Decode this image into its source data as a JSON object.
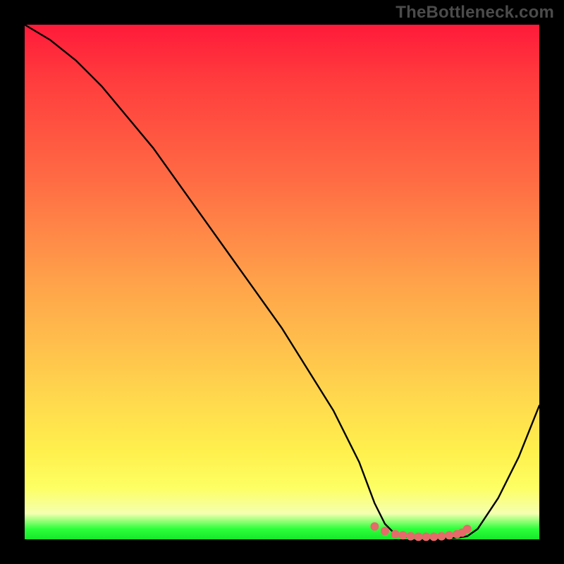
{
  "watermark": "TheBottleneck.com",
  "chart_data": {
    "type": "line",
    "title": "",
    "xlabel": "",
    "ylabel": "",
    "xlim": [
      0,
      100
    ],
    "ylim": [
      0,
      100
    ],
    "series": [
      {
        "name": "curve",
        "x": [
          0,
          5,
          10,
          15,
          20,
          25,
          30,
          35,
          40,
          45,
          50,
          55,
          60,
          65,
          68,
          70,
          72,
          74,
          76,
          78,
          80,
          82,
          84,
          86,
          88,
          92,
          96,
          100
        ],
        "y": [
          100,
          97,
          93,
          88,
          82,
          76,
          69,
          62,
          55,
          48,
          41,
          33,
          25,
          15,
          7,
          3,
          1,
          0.5,
          0.3,
          0.2,
          0.2,
          0.2,
          0.3,
          0.6,
          2,
          8,
          16,
          26
        ]
      }
    ],
    "markers": {
      "name": "bottom-dots",
      "x": [
        68,
        70,
        72,
        73.5,
        75,
        76.5,
        78,
        79.5,
        81,
        82.5,
        84,
        85,
        86
      ],
      "y": [
        2.5,
        1.6,
        1.0,
        0.8,
        0.6,
        0.5,
        0.5,
        0.5,
        0.6,
        0.8,
        1.0,
        1.3,
        2.0
      ],
      "color": "#e66a6a",
      "radius": 6
    },
    "colors": {
      "curve": "#000000",
      "background_gradient": [
        "#ff1a3a",
        "#ff6b44",
        "#ffd24d",
        "#fdff63",
        "#16e82a"
      ],
      "frame": "#000000"
    }
  }
}
